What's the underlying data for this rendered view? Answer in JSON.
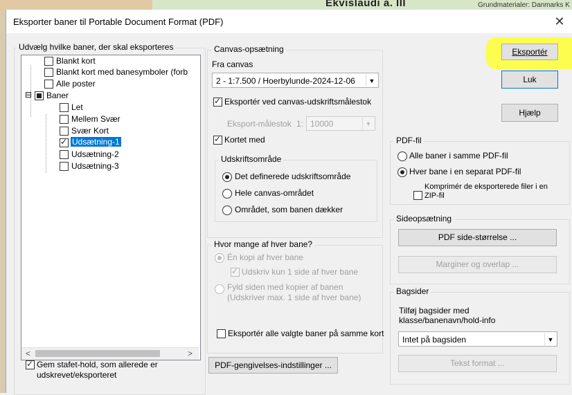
{
  "background": {
    "map_title": "Ekvislaudi a. III",
    "map_info": "Grundmaterialer: Danmarks K"
  },
  "dialog": {
    "title": "Eksporter baner til Portable Document Format (PDF)",
    "close_glyph": "✕"
  },
  "courses": {
    "group_title": "Udvælg hvilke baner, der skal eksporteres",
    "items": [
      {
        "label": "Blankt kort",
        "checked": false
      },
      {
        "label": "Blankt kort med banesymboler (forb",
        "checked": false
      },
      {
        "label": "Alle poster",
        "checked": false
      },
      {
        "label": "Baner",
        "checked": "partial",
        "expand": "⊟"
      },
      {
        "label": "Let",
        "checked": false
      },
      {
        "label": "Mellem Svær",
        "checked": false
      },
      {
        "label": "Svær Kort",
        "checked": false
      },
      {
        "label": "Udsætning-1",
        "checked": true,
        "selected": true
      },
      {
        "label": "Udsætning-2",
        "checked": false
      },
      {
        "label": "Udsætning-3",
        "checked": false
      }
    ],
    "scroll_left": "<",
    "scroll_right": ">",
    "relay_label": "Gem stafet-hold, som allerede er udskrevet/eksporteret",
    "relay_checked": true
  },
  "canvas": {
    "group_title": "Canvas-opsætning",
    "from_canvas_label": "Fra canvas",
    "canvas_value": "2 - 1:7.500 / Hoerbylunde-2024-12-06",
    "export_scale_label": "Eksportér ved canvas-udskriftsmålestok",
    "export_scale_checked": true,
    "scale_label": "Eksport-målestok",
    "scale_prefix": "1:",
    "scale_value": "10000",
    "with_map_label": "Kortet med",
    "with_map_checked": true,
    "print_area_title": "Udskriftsområde",
    "print_area_options": [
      "Det definerede udskriftsområde",
      "Hele canvas-området",
      "Området, som banen dækker"
    ],
    "print_area_selected": 0
  },
  "copies": {
    "group_title": "Hvor mange af hver bane?",
    "one_copy": "Én kopi af hver bane",
    "one_side_only": "Udskriv kun 1 side af hver bane",
    "fill_page": "Fyld siden med kopier af banen",
    "fill_page_note": "(Udskriver max. 1 side af hver bane)",
    "export_same_map": "Eksportér alle valgte baner på samme kort"
  },
  "render_settings_button": "PDF-gengivelses-indstillinger ...",
  "buttons": {
    "export": "Eksportér",
    "close": "Luk",
    "help": "Hjælp"
  },
  "pdf_file": {
    "group_title": "PDF-fil",
    "all_same": "Alle baner i samme PDF-fil",
    "separate": "Hver bane i en separat PDF-fil",
    "selected": 1,
    "zip_label_1": "Komprimér de eksporterede filer i en",
    "zip_label_2": "ZIP-fil",
    "zip_checked": false
  },
  "page_setup": {
    "group_title": "Sideopsætning",
    "page_size_button": "PDF side-størrelse ...",
    "margins_button": "Marginer og overlap ..."
  },
  "back_pages": {
    "group_title": "Bagsider",
    "description_1": "Tilføj bagsider med",
    "description_2": "klasse/banenavn/hold-info",
    "option_value": "Intet på bagsiden",
    "text_format_button": "Tekst format ..."
  },
  "colors": {
    "highlight": "#ffff33",
    "accent": "#0078d7"
  }
}
